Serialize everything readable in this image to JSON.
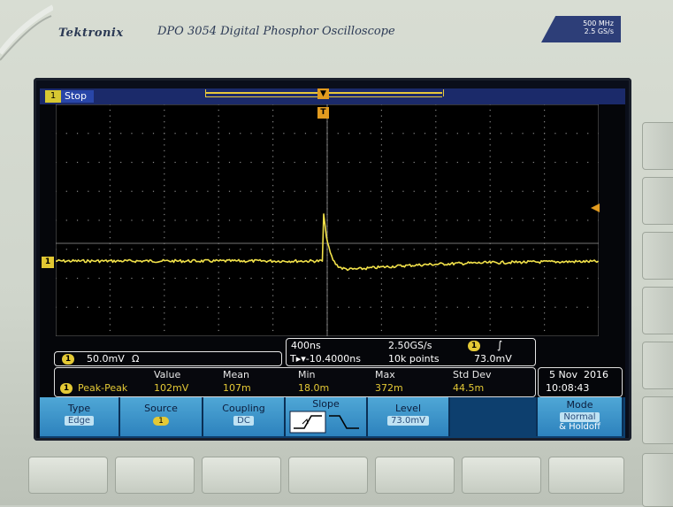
{
  "header": {
    "brand": "Tektronix",
    "model": "DPO 3054 Digital Phosphor Oscilloscope",
    "spec_bandwidth": "500 MHz",
    "spec_rate": "2.5 GS/s"
  },
  "status": {
    "channel_tag": "1",
    "acq_state": "Stop"
  },
  "markers": {
    "trigger_tag": "T",
    "channel_tag": "1"
  },
  "channel_info": {
    "tag": "1",
    "scale": "50.0mV",
    "impedance": "Ω"
  },
  "timebase": {
    "time_div": "400ns",
    "sample_rate": "2.50GS/s",
    "trig_pos": "T▸▾-10.4000ns",
    "record_length": "10k points",
    "trig_source_tag": "1",
    "trig_slope_symbol": "∫",
    "trig_level": "73.0mV"
  },
  "measurements": {
    "headers": [
      "Value",
      "Mean",
      "Min",
      "Max",
      "Std Dev"
    ],
    "row": {
      "tag": "1",
      "name": "Peak-Peak",
      "value": "102mV",
      "mean": "107m",
      "min": "18.0m",
      "max": "372m",
      "std_dev": "44.5m"
    }
  },
  "datetime": {
    "date": "5 Nov  2016",
    "time": "10:08:43"
  },
  "softkeys": {
    "type_label": "Type",
    "type_value": "Edge",
    "source_label": "Source",
    "source_value": "1",
    "coupling_label": "Coupling",
    "coupling_value": "DC",
    "slope_label": "Slope",
    "level_label": "Level",
    "level_value": "73.0mV",
    "mode_label": "Mode",
    "mode_value": "Normal",
    "mode_value2": "& Holdoff"
  },
  "colors": {
    "trace": "#f2e24a",
    "trigger": "#e29b1f",
    "softkey": "#3a93cb"
  }
}
